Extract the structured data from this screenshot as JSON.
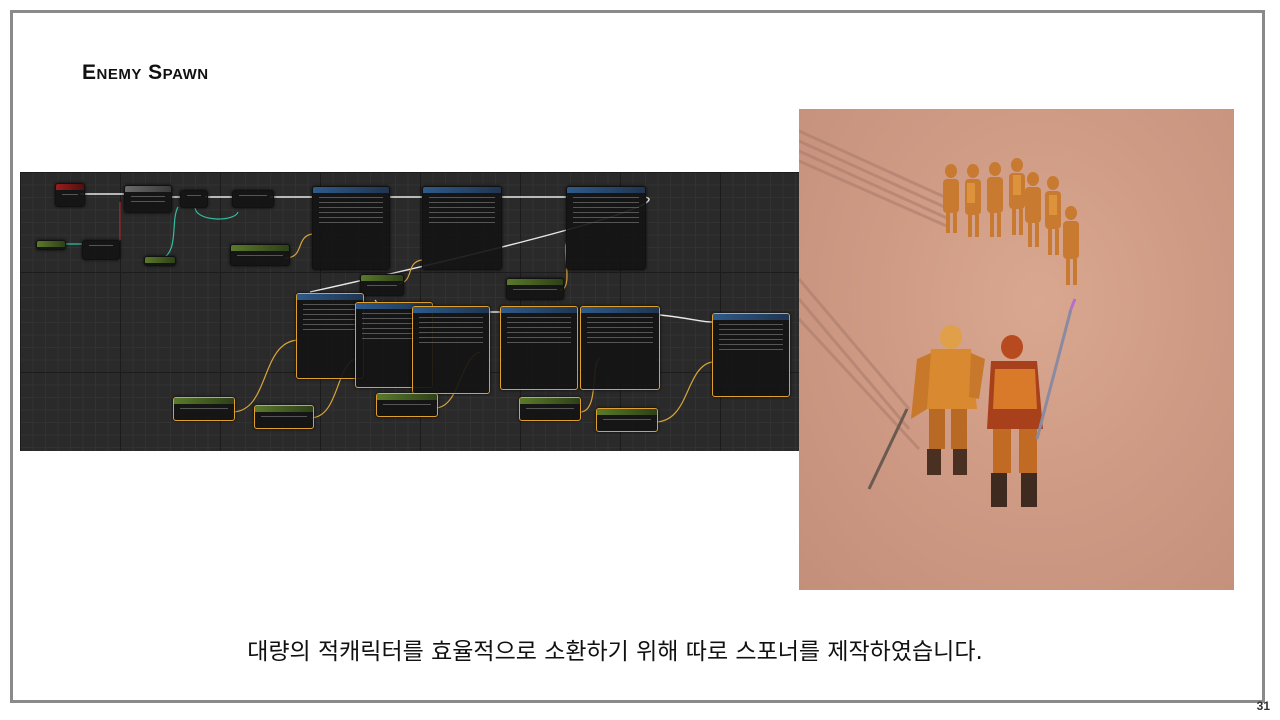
{
  "slide": {
    "title": "Enemy Spawn",
    "caption": "대량의 적캐릭터를 효율적으로 소환하기 위해 따로 스포너를 제작하였습니다.",
    "page_number": "31"
  },
  "blueprint": {
    "description_tag": "spawn-blueprint-graph",
    "colors": {
      "background": "#2a2a2a",
      "exec_wire": "#e8e8e8",
      "data_wire_yellow": "#d9a53a",
      "data_wire_teal": "#2fbf9f"
    }
  },
  "render": {
    "description_tag": "in-game-render",
    "colors": {
      "ground": "#cf9b85",
      "character": "#d97a2a"
    }
  }
}
